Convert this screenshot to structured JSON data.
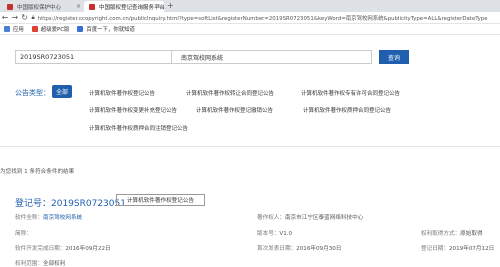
{
  "browser": {
    "tabs": [
      {
        "label": "中国版权保护中心"
      },
      {
        "label": "中国版权登记查询服务平台"
      }
    ],
    "new_tab": "+",
    "url": "https://register.ccopyright.com.cn/publicInquiry.html?type=softList&registerNumber=2019SR0723051&keyWord=南京驾校网系统&publicityType=ALL&registerDateType",
    "bookmarks": [
      {
        "label": "应用",
        "color": "#4a7fd4"
      },
      {
        "label": "超级爱PC版",
        "color": "#e0402f"
      },
      {
        "label": "百度一下，你就知道",
        "color": "#3a6fd8"
      }
    ]
  },
  "search": {
    "register_number": "2019SR0723051",
    "keyword": "南京驾校网系统",
    "button": "查询"
  },
  "categories": {
    "label": "公告类型：",
    "all": "全部",
    "items": [
      "计算机软件著作权登记公告",
      "计算机软件著作权转让合同登记公告",
      "计算机软件著作权专有许可合同登记公告",
      "计算机软件著作权变更补充登记公告",
      "计算机软件著作权登记撤销公告",
      "计算机软件著作权质押合同登记公告",
      "计算机软件著作权质押合同注销登记公告"
    ]
  },
  "results": {
    "count_text": "为您找到 1 条符合条件的结果"
  },
  "record": {
    "reg_no": "登记号：2019SR0723051",
    "tag": "计算机软件著作权登记公告",
    "software_name_label": "软件全称：",
    "software_name": "南京驾校网系统",
    "owner_label": "著作权人：",
    "owner": "南京市江宁区泰蓝网络科技中心",
    "abbr_label": "简称：",
    "abbr": "",
    "version_label": "版本号：",
    "version": "V1.0",
    "acquire_label": "权利取得方式：",
    "acquire": "原始取得",
    "dev_date_label": "软件开发完成日期：",
    "dev_date": "2016年09月22日",
    "publish_label": "首次发表日期：",
    "publish": "2016年09月30日",
    "reg_date_label": "登记日期：",
    "reg_date": "2019年07月12日",
    "scope_label": "权利范围：",
    "scope": "全部权利"
  },
  "colors": {
    "accent": "#1f5fae",
    "tab_bar": "#dee1e6"
  }
}
